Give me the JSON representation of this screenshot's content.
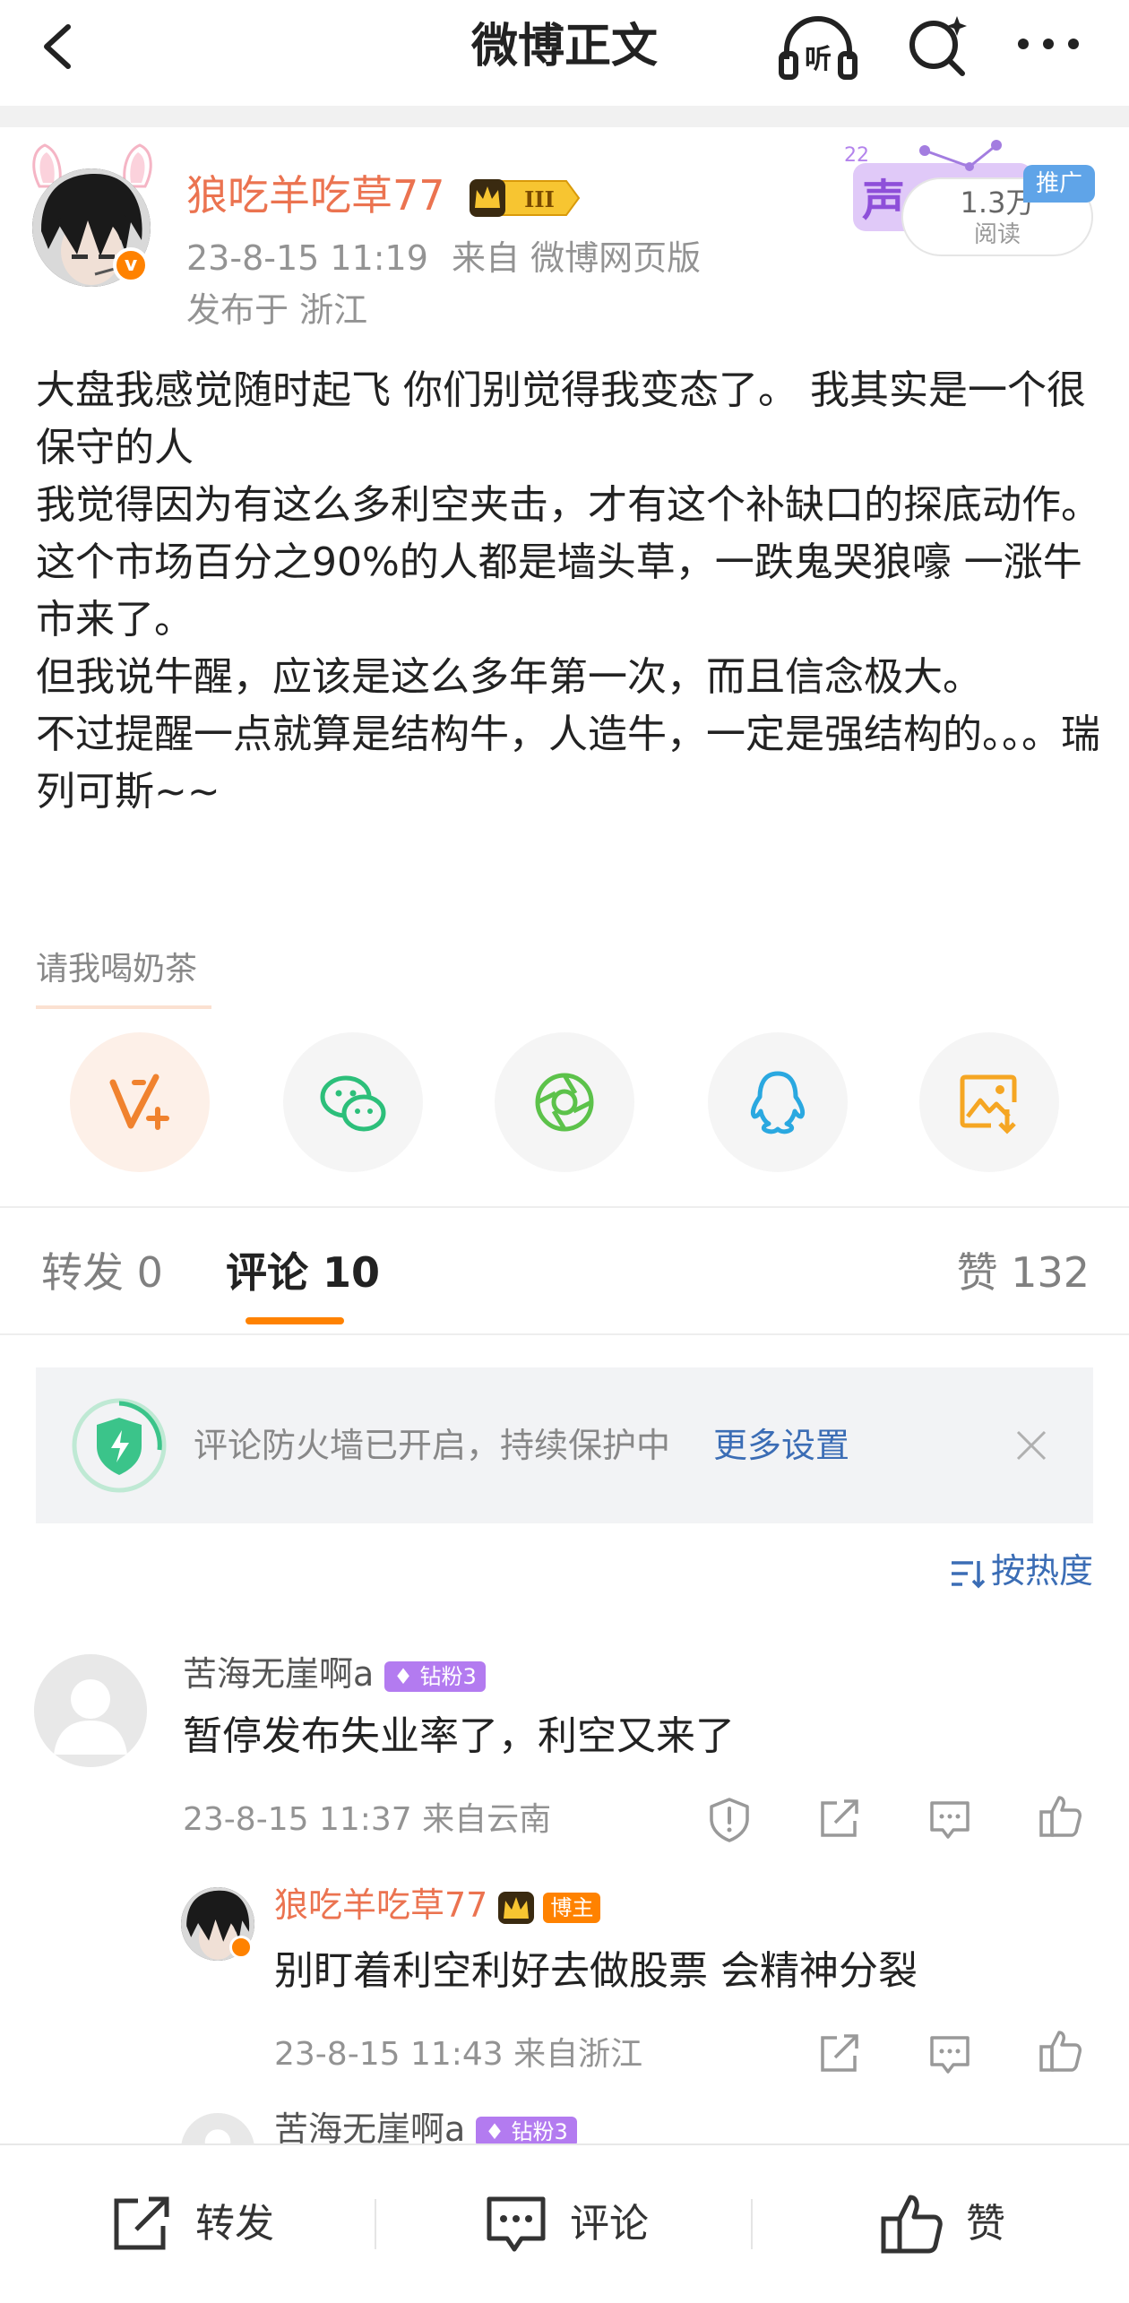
{
  "header": {
    "title": "微博正文"
  },
  "post": {
    "author": "狼吃羊吃草77",
    "verified_mark": "v",
    "time": "23-8-15 11:19",
    "source": "来自 微博网页版",
    "location": "发布于 浙江",
    "reads": "1.3万",
    "reads_label": "阅读",
    "promo_tag": "推广",
    "body": [
      "大盘我感觉随时起飞 你们别觉得我变态了。 我其实是一个很保守的人",
      "我觉得因为有这么多利空夹击，才有这个补缺口的探底动作。",
      "这个市场百分之90%的人都是墙头草，一跌鬼哭狼嚎 一涨牛市来了。",
      "但我说牛醒，应该是这么多年第一次，而且信念极大。",
      "不过提醒一点就算是结构牛，人造牛，一定是强结构的。。。瑞列可斯~~"
    ]
  },
  "tip": {
    "label": "请我喝奶茶"
  },
  "share": [
    "v-plus-icon",
    "wechat-icon",
    "moments-icon",
    "qq-icon",
    "save-image-icon"
  ],
  "colors": {
    "accent": "#ff8200",
    "author_name": "#eb7350",
    "link": "#3b6db5"
  },
  "tabs": {
    "repost": "转发 0",
    "comment": "评论 10",
    "like": "赞 132"
  },
  "firewall": {
    "text": "评论防火墙已开启，持续保护中",
    "link": "更多设置"
  },
  "sort": {
    "label": "按热度"
  },
  "comments": [
    {
      "name": "苦海无崖啊a",
      "badge": "钻粉3",
      "text": "暂停发布失业率了，利空又来了",
      "meta": "23-8-15 11:37 来自云南"
    },
    {
      "name": "狼吃羊吃草77",
      "badge": "博主",
      "text": "别盯着利空利好去做股票  会精神分裂",
      "meta": "23-8-15 11:43 来自浙江"
    },
    {
      "name": "苦海无崖啊a",
      "badge": "钻粉3"
    }
  ],
  "bottom_bar": {
    "repost": "转发",
    "comment": "评论",
    "like": "赞"
  }
}
